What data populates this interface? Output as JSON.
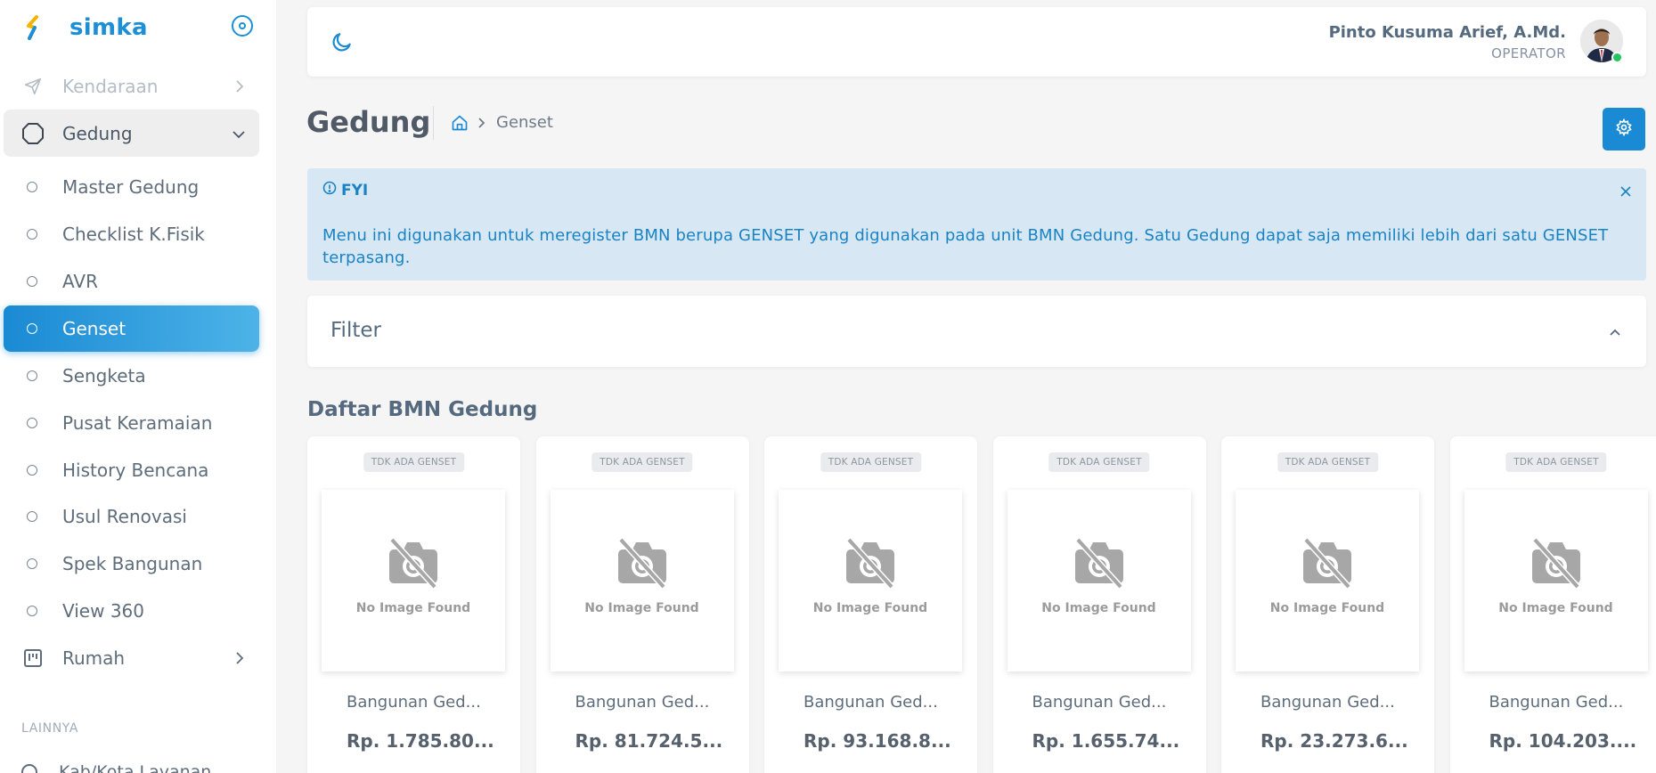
{
  "brand": {
    "name": "simka"
  },
  "sidebar": {
    "items": [
      {
        "label": "Kendaraan",
        "icon": "send-icon",
        "state": "disabled"
      },
      {
        "label": "Gedung",
        "icon": "octagon-icon",
        "state": "open"
      }
    ],
    "submenu": [
      {
        "label": "Master Gedung"
      },
      {
        "label": "Checklist K.Fisik"
      },
      {
        "label": "AVR"
      },
      {
        "label": "Genset",
        "active": true
      },
      {
        "label": "Sengketa"
      },
      {
        "label": "Pusat Keramaian"
      },
      {
        "label": "History Bencana"
      },
      {
        "label": "Usul Renovasi"
      },
      {
        "label": "Spek Bangunan"
      },
      {
        "label": "View 360"
      }
    ],
    "rumah": {
      "label": "Rumah",
      "icon": "board-icon"
    },
    "section_header": "LAINNYA",
    "cut_item": "Kab/Kota Layanan"
  },
  "navbar": {
    "user_name": "Pinto Kusuma Arief, A.Md.",
    "user_role": "OPERATOR"
  },
  "page": {
    "title": "Gedung",
    "breadcrumb_current": "Genset"
  },
  "alert": {
    "title": "FYI",
    "text": "Menu ini digunakan untuk meregister BMN berupa GENSET yang digunakan pada unit BMN Gedung. Satu Gedung dapat saja memiliki lebih dari satu GENSET terpasang."
  },
  "filter": {
    "title": "Filter"
  },
  "list": {
    "title": "Daftar BMN Gedung",
    "cards": [
      {
        "badge": "TDK ADA GENSET",
        "image_text": "No Image Found",
        "name": "Bangunan Ged...",
        "price": "Rp. 1.785.80..."
      },
      {
        "badge": "TDK ADA GENSET",
        "image_text": "No Image Found",
        "name": "Bangunan Ged...",
        "price": "Rp. 81.724.5..."
      },
      {
        "badge": "TDK ADA GENSET",
        "image_text": "No Image Found",
        "name": "Bangunan Ged...",
        "price": "Rp. 93.168.8..."
      },
      {
        "badge": "TDK ADA GENSET",
        "image_text": "No Image Found",
        "name": "Bangunan Ged...",
        "price": "Rp. 1.655.74..."
      },
      {
        "badge": "TDK ADA GENSET",
        "image_text": "No Image Found",
        "name": "Bangunan Ged...",
        "price": "Rp. 23.273.6..."
      },
      {
        "badge": "TDK ADA GENSET",
        "image_text": "No Image Found",
        "name": "Bangunan Ged...",
        "price": "Rp. 104.203...."
      }
    ]
  },
  "colors": {
    "primary": "#1a8ad4",
    "alert_bg": "#d7e8f4",
    "online": "#22c55e"
  }
}
